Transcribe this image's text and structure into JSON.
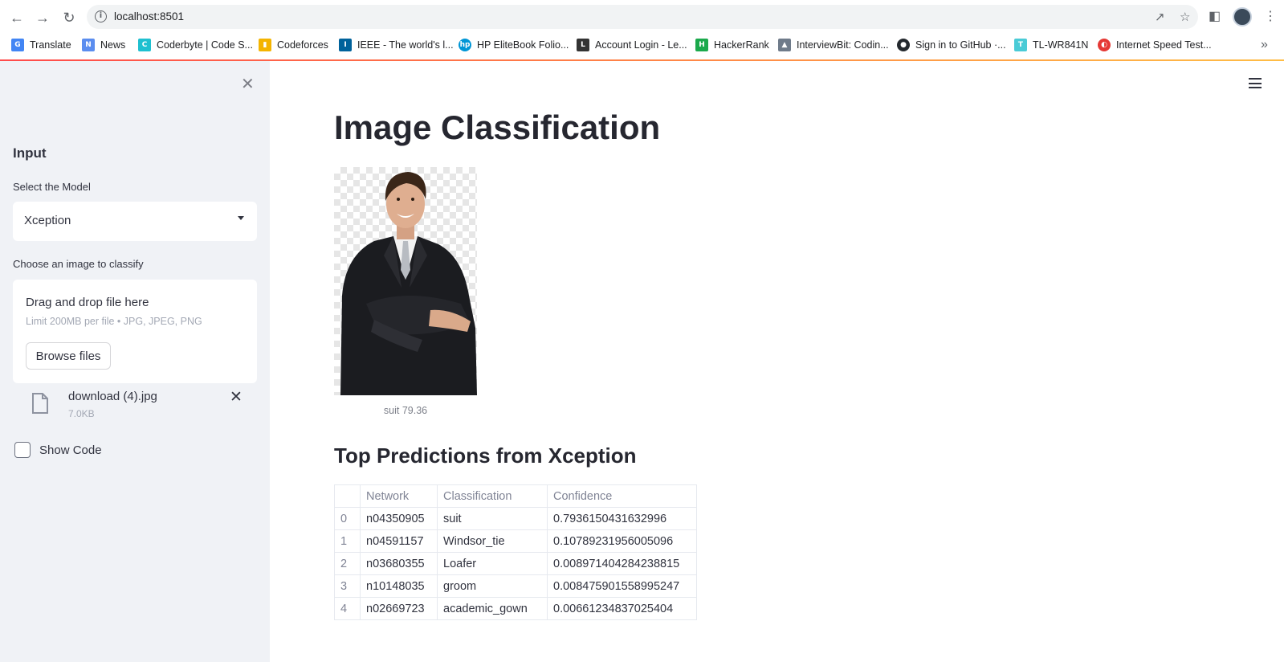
{
  "browser": {
    "url": "localhost:8501",
    "bookmarks": [
      {
        "label": "Translate",
        "icon": "google-translate-icon",
        "color": "#4285f4"
      },
      {
        "label": "News",
        "icon": "google-news-icon",
        "color": "#5b8def"
      },
      {
        "label": "Coderbyte | Code S...",
        "icon": "coderbyte-icon",
        "color": "#1fc0d0"
      },
      {
        "label": "Codeforces",
        "icon": "codeforces-icon",
        "color": "#f4b400"
      },
      {
        "label": "IEEE - The world's l...",
        "icon": "ieee-icon",
        "color": "#00629b"
      },
      {
        "label": "HP EliteBook Folio...",
        "icon": "hp-icon",
        "color": "#0096d6"
      },
      {
        "label": "Account Login - Le...",
        "icon": "leetcode-icon",
        "color": "#333333"
      },
      {
        "label": "HackerRank",
        "icon": "hackerrank-icon",
        "color": "#1ba94c"
      },
      {
        "label": "InterviewBit: Codin...",
        "icon": "interviewbit-icon",
        "color": "#6f7b8a"
      },
      {
        "label": "Sign in to GitHub ·...",
        "icon": "github-icon",
        "color": "#24292e"
      },
      {
        "label": "TL-WR841N",
        "icon": "tplink-icon",
        "color": "#4acbd6"
      },
      {
        "label": "Internet Speed Test...",
        "icon": "speedtest-icon",
        "color": "#e53935"
      }
    ]
  },
  "sidebar": {
    "heading": "Input",
    "model_label": "Select the Model",
    "model_value": "Xception",
    "uploader_label": "Choose an image to classify",
    "dropzone_title": "Drag and drop file here",
    "dropzone_limit": "Limit 200MB per file • JPG, JPEG, PNG",
    "browse_label": "Browse files",
    "file_name": "download (4).jpg",
    "file_size": "7.0KB",
    "show_code_label": "Show Code"
  },
  "main": {
    "title": "Image Classification",
    "image_caption": "suit 79.36",
    "predictions_title": "Top Predictions from Xception",
    "table": {
      "columns": [
        "",
        "Network",
        "Classification",
        "Confidence"
      ],
      "rows": [
        [
          "0",
          "n04350905",
          "suit",
          "0.7936150431632996"
        ],
        [
          "1",
          "n04591157",
          "Windsor_tie",
          "0.10789231956005096"
        ],
        [
          "2",
          "n03680355",
          "Loafer",
          "0.008971404284238815"
        ],
        [
          "3",
          "n10148035",
          "groom",
          "0.008475901558995247"
        ],
        [
          "4",
          "n02669723",
          "academic_gown",
          "0.00661234837025404"
        ]
      ]
    }
  }
}
